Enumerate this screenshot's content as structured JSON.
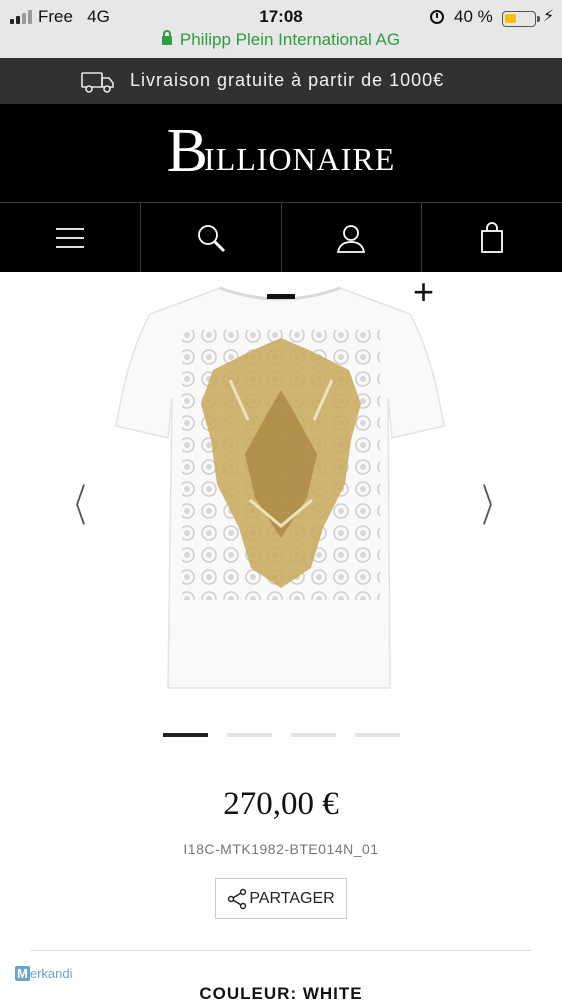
{
  "status_bar": {
    "carrier": "Free",
    "network": "4G",
    "time": "17:08",
    "battery": "40 %",
    "battery_level": 0.4,
    "site_owner": "Philipp Plein International AG",
    "colors": {
      "url": "#2e9e3e",
      "battery": "#f4c20d"
    }
  },
  "shipping_banner": {
    "text": "Livraison gratuite à partir de 1000€",
    "icon": "truck-icon"
  },
  "header": {
    "logo_initial": "B",
    "logo_rest": "ILLIONAIRE"
  },
  "nav": {
    "items": [
      {
        "name": "menu",
        "icon": "hamburger-menu-icon"
      },
      {
        "name": "search",
        "icon": "search-icon"
      },
      {
        "name": "account",
        "icon": "user-icon"
      },
      {
        "name": "cart",
        "icon": "shopping-bag-icon"
      }
    ]
  },
  "gallery": {
    "zoom": "+",
    "prev": "〈",
    "next": "〉",
    "slide_count": 4,
    "active_slide": 1
  },
  "product": {
    "price": "270,00 €",
    "sku": "I18C-MTK1982-BTE014N_01",
    "share_label": "PARTAGER",
    "color_label": "COULEUR: WHITE"
  },
  "watermark": {
    "m": "M",
    "rest": "erkandi"
  }
}
